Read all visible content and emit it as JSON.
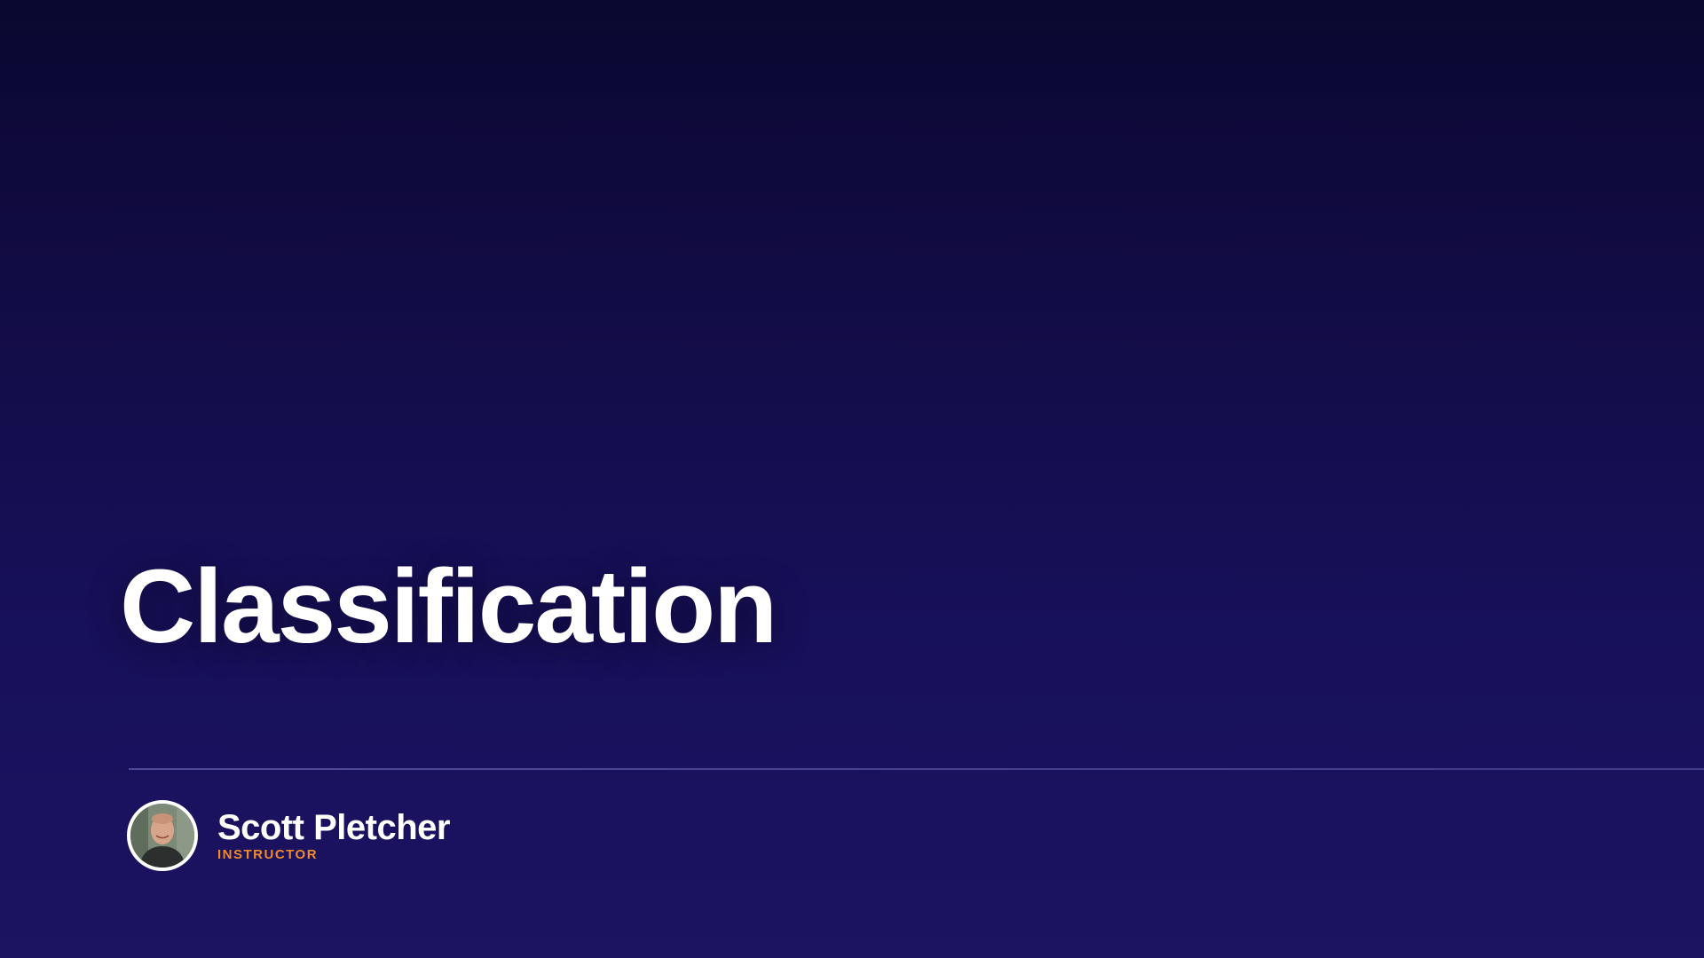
{
  "slide": {
    "title": "Classification"
  },
  "presenter": {
    "name": "Scott Pletcher",
    "role": "INSTRUCTOR",
    "avatar_icon": "person-photo-icon"
  },
  "colors": {
    "background_top": "#0a0730",
    "background_bottom": "#1c1361",
    "title": "#ffffff",
    "role_accent": "#f08a2c"
  }
}
